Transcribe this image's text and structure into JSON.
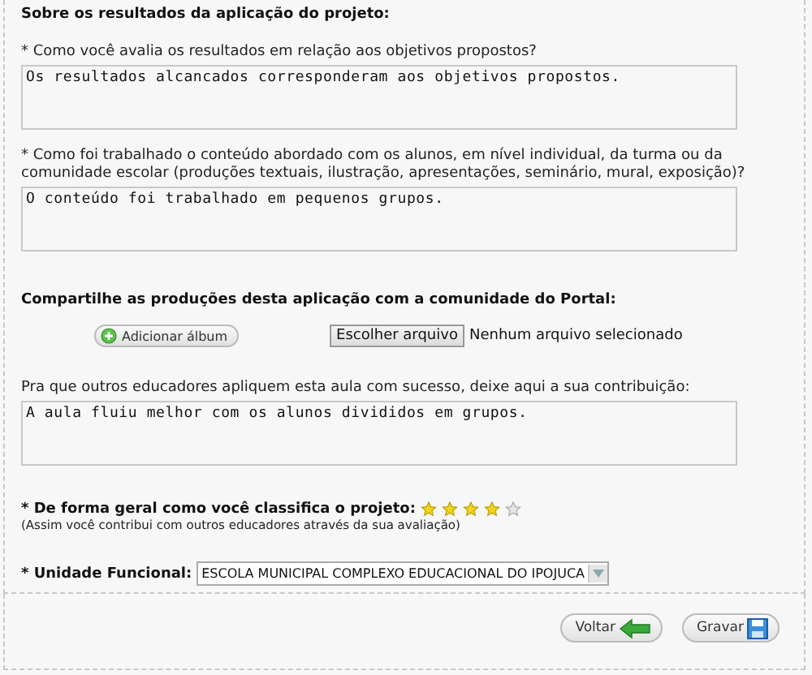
{
  "results_section": {
    "title": "Sobre os resultados da aplicação do projeto:",
    "questions": [
      {
        "label": "* Como você avalia os resultados em relação aos objetivos propostos?",
        "value": "Os resultados alcancados corresponderam aos objetivos propostos."
      },
      {
        "label": "* Como foi trabalhado o conteúdo abordado com os alunos, em nível individual, da turma ou da comunidade escolar (produções textuais, ilustração, apresentações, seminário, mural, exposição)?",
        "value": "O conteúdo foi trabalhado em pequenos grupos."
      }
    ]
  },
  "share_section": {
    "title": "Compartilhe as produções desta aplicação com a comunidade do Portal:",
    "add_album_button": "Adicionar álbum",
    "file_button": "Escolher arquivo",
    "file_status": "Nenhum arquivo selecionado"
  },
  "contribution": {
    "label": "Pra que outros educadores apliquem esta aula com sucesso, deixe aqui a sua contribuição:",
    "value": "A aula fluiu melhor com os alunos divididos em grupos."
  },
  "rating": {
    "label": "* De forma geral como você classifica o projeto:",
    "stars": 4,
    "note": "(Assim você contribui com outros educadores através da sua avaliação)"
  },
  "unit": {
    "label": "* Unidade Funcional:",
    "value": "ESCOLA MUNICIPAL COMPLEXO EDUCACIONAL DO IPOJUCA"
  },
  "footer_buttons": [
    {
      "kind": "back",
      "label": "Voltar"
    },
    {
      "kind": "save",
      "label": "Gravar"
    }
  ]
}
